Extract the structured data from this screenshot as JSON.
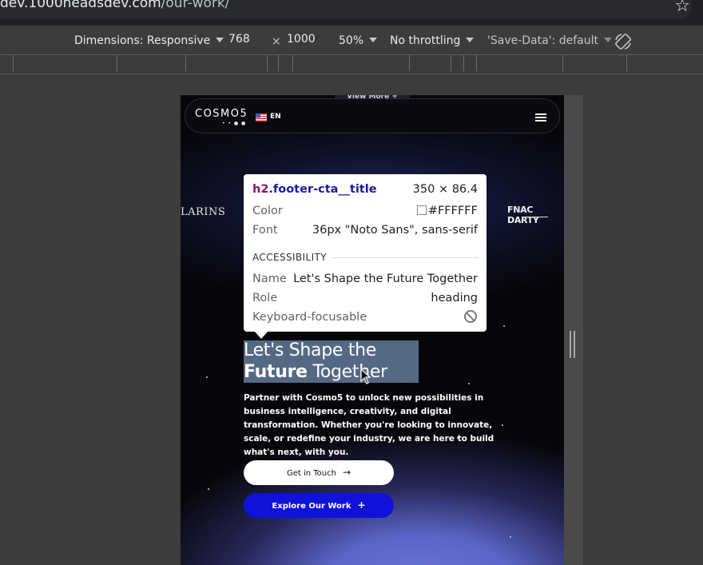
{
  "browser": {
    "url_host": "dev.1000headsdev.com",
    "url_path": "/our-work/"
  },
  "devtools_toolbar": {
    "dimensions_label": "Dimensions: Responsive",
    "width": "768",
    "times": "×",
    "height": "1000",
    "zoom": "50%",
    "throttling": "No throttling",
    "save_data": "'Save-Data': default"
  },
  "page": {
    "view_more": "View More  +",
    "logo": "COSMO5",
    "lang": "EN",
    "brand_left": "LARINS",
    "brand_right": "FNAC DARTY",
    "cta_title_line1": "Let's Shape the",
    "cta_title_bold": "Future",
    "cta_title_rest": " Together",
    "cta_text": "Partner with Cosmo5 to unlock new possibilities in business intelligence, creativity, and digital transformation. Whether you're looking to innovate, scale, or redefine your industry, we are here to build what's next, with you.",
    "btn_touch": "Get in Touch",
    "btn_explore": "Explore Our Work"
  },
  "inspect_tooltip": {
    "selector_tag": "h2",
    "selector_class": ".footer-cta__title",
    "size": "350 × 86.4",
    "color_label": "Color",
    "color_value": "#FFFFFF",
    "font_label": "Font",
    "font_value": "36px \"Noto Sans\", sans-serif",
    "accessibility_heading": "ACCESSIBILITY",
    "name_label": "Name",
    "name_value": "Let's Shape the Future Together",
    "role_label": "Role",
    "role_value": "heading",
    "focus_label": "Keyboard-focusable"
  },
  "icons": {
    "star": "★",
    "rotate": "rotate-icon",
    "arrow": "→",
    "plus": "+"
  }
}
